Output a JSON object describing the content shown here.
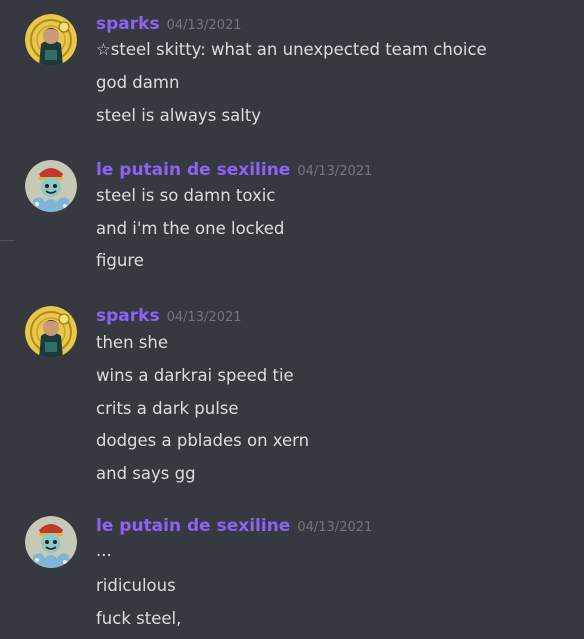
{
  "messages": [
    {
      "username": "sparks",
      "timestamp": "04/13/2021",
      "avatar_icon": "sparks-avatar-icon",
      "lines": [
        "☆steel skitty: what an unexpected team choice",
        "god damn",
        "steel is always salty"
      ]
    },
    {
      "username": "le putain de sexiline",
      "timestamp": "04/13/2021",
      "avatar_icon": "sexiline-avatar-icon",
      "lines": [
        "steel is so damn toxic",
        "and i'm the one locked",
        "figure"
      ]
    },
    {
      "username": "sparks",
      "timestamp": "04/13/2021",
      "avatar_icon": "sparks-avatar-icon",
      "lines": [
        "then she",
        "wins a darkrai speed tie",
        "crits a dark pulse",
        "dodges a pblades on xern",
        "and says gg"
      ]
    },
    {
      "username": "le putain de sexiline",
      "timestamp": "04/13/2021",
      "avatar_icon": "sexiline-avatar-icon",
      "lines": [
        "...",
        "ridiculous",
        "fuck steel,"
      ]
    }
  ],
  "colors": {
    "background": "#36393f",
    "username": "#8d63f5",
    "timestamp": "#72767d",
    "message_text": "#dcddde"
  }
}
